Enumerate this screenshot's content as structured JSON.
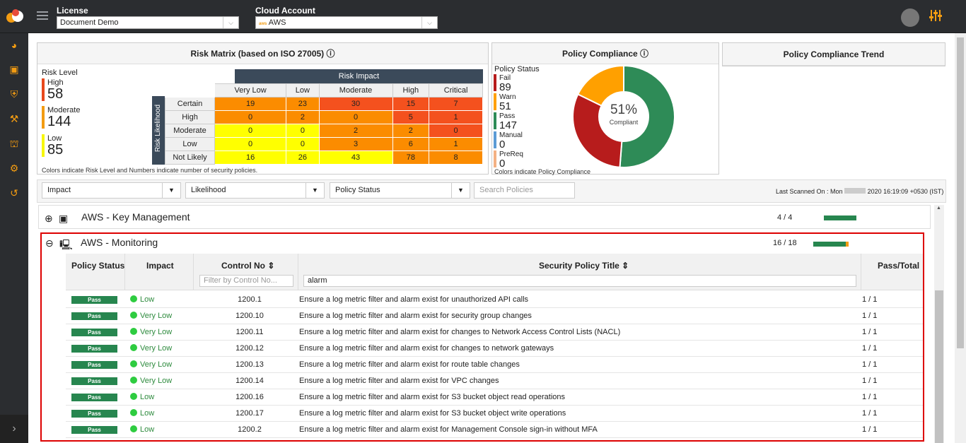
{
  "header": {
    "license_label": "License",
    "license_value": "Document Demo",
    "cloud_label": "Cloud Account",
    "cloud_value": "AWS",
    "cloud_prefix": "aws"
  },
  "risk_matrix": {
    "title": "Risk Matrix (based on ISO 27005)",
    "risk_level_label": "Risk Level",
    "levels": [
      {
        "label": "High",
        "value": "58",
        "color": "#e8481c"
      },
      {
        "label": "Moderate",
        "value": "144",
        "color": "#f39c12"
      },
      {
        "label": "Low",
        "value": "85",
        "color": "#f7f70a"
      }
    ],
    "impact_header": "Risk Impact",
    "likelihood_header": "Risk Likelihood",
    "impact_cols": [
      "Very Low",
      "Low",
      "Moderate",
      "High",
      "Critical"
    ],
    "rows": [
      {
        "label": "Certain",
        "cells": [
          "19",
          "23",
          "30",
          "15",
          "7"
        ],
        "colors": [
          "#fb8c00",
          "#fb8c00",
          "#f4511e",
          "#f4511e",
          "#f4511e"
        ]
      },
      {
        "label": "High",
        "cells": [
          "0",
          "2",
          "0",
          "5",
          "1"
        ],
        "colors": [
          "#fb8c00",
          "#fb8c00",
          "#fb8c00",
          "#f4511e",
          "#f4511e"
        ]
      },
      {
        "label": "Moderate",
        "cells": [
          "0",
          "0",
          "2",
          "2",
          "0"
        ],
        "colors": [
          "#ffff00",
          "#ffff00",
          "#fb8c00",
          "#fb8c00",
          "#f4511e"
        ]
      },
      {
        "label": "Low",
        "cells": [
          "0",
          "0",
          "3",
          "6",
          "1"
        ],
        "colors": [
          "#ffff00",
          "#ffff00",
          "#fb8c00",
          "#fb8c00",
          "#fb8c00"
        ]
      },
      {
        "label": "Not Likely",
        "cells": [
          "16",
          "26",
          "43",
          "78",
          "8"
        ],
        "colors": [
          "#ffff00",
          "#ffff00",
          "#ffff00",
          "#fb8c00",
          "#fb8c00"
        ]
      }
    ],
    "note": "Colors indicate Risk Level and Numbers indicate number of security policies."
  },
  "compliance": {
    "title": "Policy Compliance",
    "status_label": "Policy Status",
    "statuses": [
      {
        "label": "Fail",
        "value": "89",
        "color": "#b71c1c"
      },
      {
        "label": "Warn",
        "value": "51",
        "color": "#ffa000"
      },
      {
        "label": "Pass",
        "value": "147",
        "color": "#2e8b57"
      },
      {
        "label": "Manual",
        "value": "0",
        "color": "#5b9bd5"
      },
      {
        "label": "PreReq",
        "value": "0",
        "color": "#f4b183"
      }
    ],
    "percent": "51%",
    "percent_label": "Compliant",
    "note": "Colors indicate Policy Compliance"
  },
  "trend": {
    "title": "Policy Compliance Trend"
  },
  "filters": {
    "impact": "Impact",
    "likelihood": "Likelihood",
    "status": "Policy Status",
    "search_placeholder": "Search Policies",
    "last_scanned": "Last Scanned On : Mon",
    "last_scanned_tail": "2020 16:19:09 +0530 (IST)"
  },
  "groups": [
    {
      "title": "AWS - Key Management",
      "count": "4 / 4"
    },
    {
      "title": "AWS - Monitoring",
      "count": "16 / 18"
    }
  ],
  "table": {
    "headers": {
      "status": "Policy Status",
      "impact": "Impact",
      "control": "Control No",
      "title": "Security Policy Title",
      "pass": "Pass/Total"
    },
    "control_placeholder": "Filter by Control No...",
    "title_filter": "alarm",
    "rows": [
      {
        "status": "Pass",
        "impact": "Low",
        "control": "1200.1",
        "title": "Ensure a log metric filter and alarm exist for unauthorized API calls",
        "pt": "1 / 1"
      },
      {
        "status": "Pass",
        "impact": "Very Low",
        "control": "1200.10",
        "title": "Ensure a log metric filter and alarm exist for security group changes",
        "pt": "1 / 1"
      },
      {
        "status": "Pass",
        "impact": "Very Low",
        "control": "1200.11",
        "title": "Ensure a log metric filter and alarm exist for changes to Network Access Control Lists (NACL)",
        "pt": "1 / 1"
      },
      {
        "status": "Pass",
        "impact": "Very Low",
        "control": "1200.12",
        "title": "Ensure a log metric filter and alarm exist for changes to network gateways",
        "pt": "1 / 1"
      },
      {
        "status": "Pass",
        "impact": "Very Low",
        "control": "1200.13",
        "title": "Ensure a log metric filter and alarm exist for route table changes",
        "pt": "1 / 1"
      },
      {
        "status": "Pass",
        "impact": "Very Low",
        "control": "1200.14",
        "title": "Ensure a log metric filter and alarm exist for VPC changes",
        "pt": "1 / 1"
      },
      {
        "status": "Pass",
        "impact": "Low",
        "control": "1200.16",
        "title": "Ensure a log metric filter and alarm exist for S3 bucket object read operations",
        "pt": "1 / 1"
      },
      {
        "status": "Pass",
        "impact": "Low",
        "control": "1200.17",
        "title": "Ensure a log metric filter and alarm exist for S3 bucket object write operations",
        "pt": "1 / 1"
      },
      {
        "status": "Pass",
        "impact": "Low",
        "control": "1200.2",
        "title": "Ensure a log metric filter and alarm exist for Management Console sign-in without MFA",
        "pt": "1 / 1"
      }
    ]
  }
}
